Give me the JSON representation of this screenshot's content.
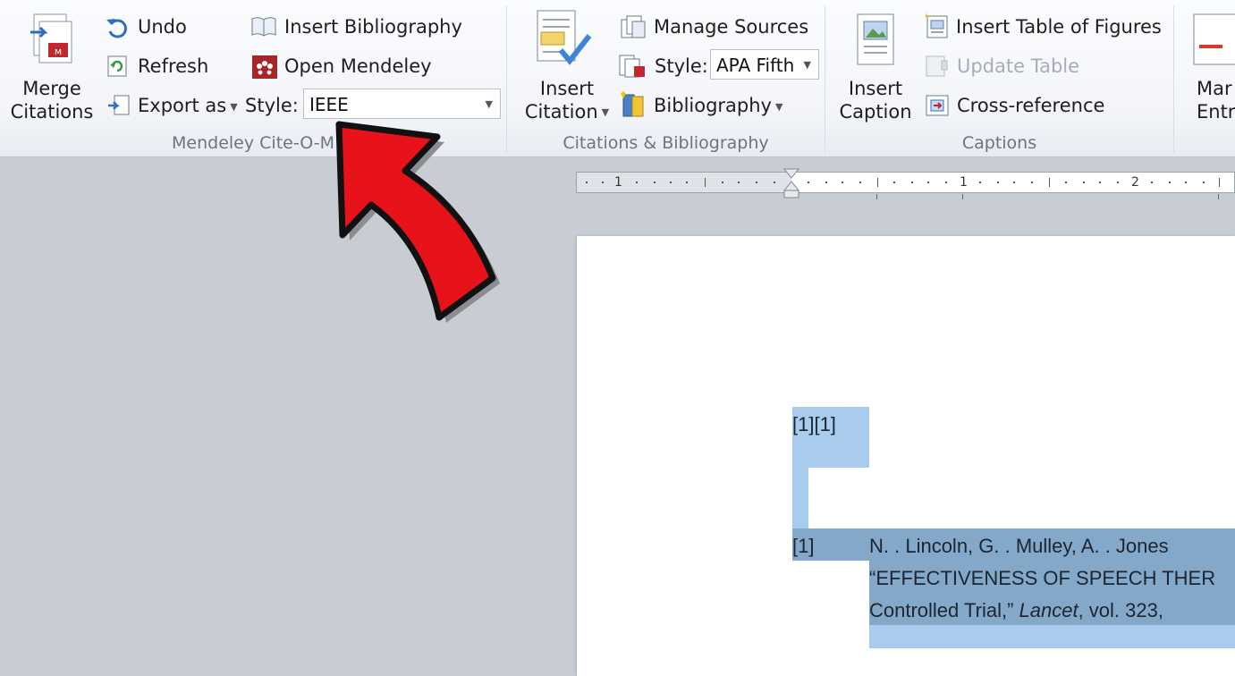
{
  "ribbon": {
    "mendeley": {
      "group_label": "Mendeley Cite-O-M",
      "merge_label_line1": "Merge",
      "merge_label_line2": "Citations",
      "undo": "Undo",
      "refresh": "Refresh",
      "export_as": "Export as",
      "insert_bibliography": "Insert Bibliography",
      "open_mendeley": "Open Mendeley",
      "style_label": "Style:",
      "style_value": "IEEE"
    },
    "citations": {
      "group_label": "Citations & Bibliography",
      "insert_citation_line1": "Insert",
      "insert_citation_line2": "Citation",
      "manage_sources": "Manage Sources",
      "style_label": "Style:",
      "style_value": "APA Fifth",
      "bibliography": "Bibliography"
    },
    "captions": {
      "group_label": "Captions",
      "insert_caption_line1": "Insert",
      "insert_caption_line2": "Caption",
      "insert_table_of_figures": "Insert Table of Figures",
      "update_table": "Update Table",
      "cross_reference": "Cross-reference"
    },
    "index": {
      "mark_entry_line1": "Mar",
      "mark_entry_line2": "Entr"
    }
  },
  "ruler": {
    "marks": [
      "1",
      "1",
      "2"
    ]
  },
  "document": {
    "citation_line": "[1][1]",
    "bib_number": "[1]",
    "bib_line1": "N. . Lincoln, G. . Mulley, A. . Jones",
    "bib_line2": "“EFFECTIVENESS OF SPEECH THER",
    "bib_line3_pre": "Controlled Trial,” ",
    "bib_line3_journal": "Lancet",
    "bib_line3_post": ", vol. 323,"
  },
  "colors": {
    "selection": "#a9cbee",
    "selection_dark": "#84a8c9",
    "arrow_red": "#e8131a"
  },
  "icons": [
    "merge-citations-icon",
    "undo-icon",
    "refresh-icon",
    "export-icon",
    "insert-bibliography-icon",
    "mendeley-icon",
    "insert-citation-icon",
    "manage-sources-icon",
    "style-icon",
    "bibliography-icon",
    "insert-caption-icon",
    "table-of-figures-icon",
    "update-table-icon",
    "cross-reference-icon",
    "mark-entry-icon"
  ]
}
